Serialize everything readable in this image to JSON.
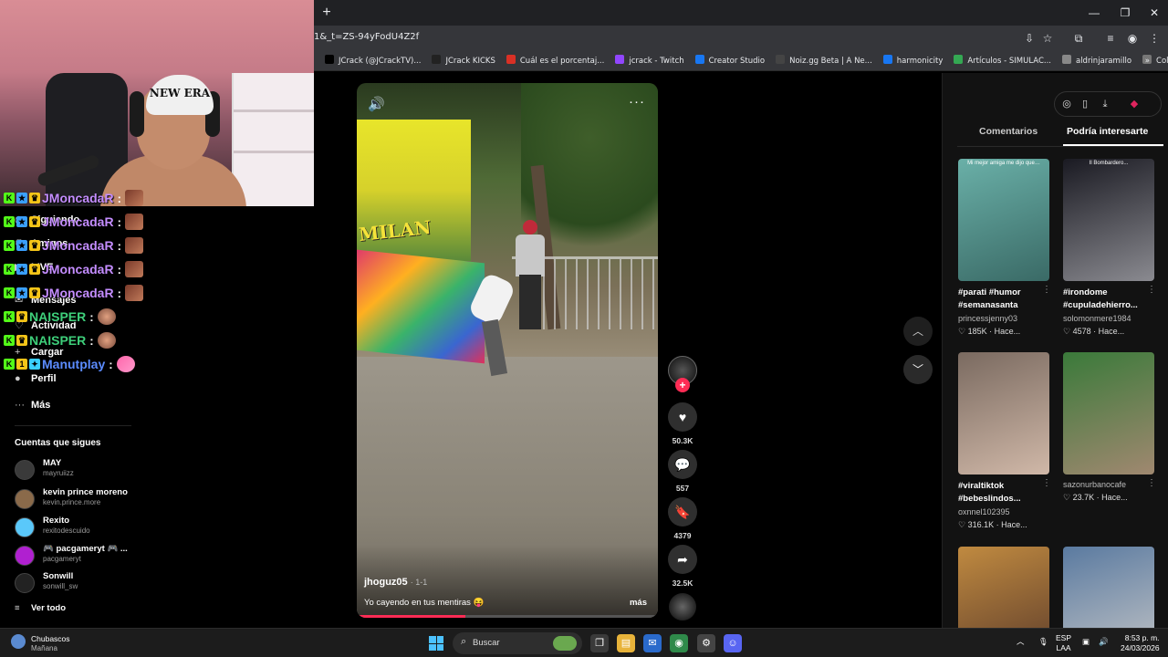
{
  "browser": {
    "new_tab": "+",
    "window_controls": [
      "—",
      "❐",
      "✕"
    ],
    "url": "1&_t=ZS-94yFodU4Z2f",
    "bookmarks": [
      {
        "label": "JCrack (@JCrackTV)...",
        "color": "#000000"
      },
      {
        "label": "JCrack KICKS",
        "color": "#222222"
      },
      {
        "label": "Cuál es el porcentaj...",
        "color": "#d93025"
      },
      {
        "label": "jcrack - Twitch",
        "color": "#9146ff"
      },
      {
        "label": "Creator Studio",
        "color": "#1877f2"
      },
      {
        "label": "Noiz.gg Beta | A Ne...",
        "color": "#444444"
      },
      {
        "label": "harmonicity",
        "color": "#1877f2"
      },
      {
        "label": "Artículos - SIMULAC...",
        "color": "#34a853"
      },
      {
        "label": "aldrinjaramillo",
        "color": "#888888"
      },
      {
        "label": "Colección de M_blei...",
        "color": "#777777"
      }
    ],
    "bookmarks_overflow": "»"
  },
  "webcam": {
    "cap_text": "NEW ERA"
  },
  "chat": [
    {
      "user": "JMoncadaR",
      "color": "#c48dff",
      "badges": [
        "K",
        "★",
        "♛"
      ]
    },
    {
      "user": "JMoncadaR",
      "color": "#c48dff",
      "badges": [
        "K",
        "★",
        "♛"
      ]
    },
    {
      "user": "JMoncadaR",
      "color": "#c48dff",
      "badges": [
        "K",
        "★",
        "♛"
      ]
    },
    {
      "user": "JMoncadaR",
      "color": "#c48dff",
      "badges": [
        "K",
        "★",
        "♛"
      ]
    },
    {
      "user": "JMoncadaR",
      "color": "#c48dff",
      "badges": [
        "K",
        "★",
        "♛"
      ]
    },
    {
      "user": "NAISPER",
      "color": "#3ecf7a",
      "badges": [
        "K",
        "♛"
      ]
    },
    {
      "user": "NAISPER",
      "color": "#3ecf7a",
      "badges": [
        "K",
        "♛"
      ]
    },
    {
      "user": "Manutplay",
      "color": "#5b8cff",
      "badges": [
        "K",
        "1",
        "✦"
      ]
    }
  ],
  "chat_colon": ":",
  "sidebar": {
    "nav": [
      {
        "label": "Siguiendo",
        "icon": "following-icon"
      },
      {
        "label": "Amigos",
        "icon": "friends-icon"
      },
      {
        "label": "LIVE",
        "icon": "live-icon"
      },
      {
        "label": "Mensajes",
        "icon": "messages-icon"
      },
      {
        "label": "Actividad",
        "icon": "activity-icon"
      },
      {
        "label": "Cargar",
        "icon": "upload-icon"
      },
      {
        "label": "Perfil",
        "icon": "profile-icon"
      },
      {
        "label": "Más",
        "icon": "more-icon"
      }
    ],
    "following_title": "Cuentas que sigues",
    "accounts": [
      {
        "name": "MAY",
        "handle": "mayruiizz",
        "color": "#3a3a3a"
      },
      {
        "name": "kevin prince moreno",
        "handle": "kevin.prince.more",
        "color": "#8a6a4a"
      },
      {
        "name": "Rexito",
        "handle": "rexitodescuido",
        "color": "#5ac8fa"
      },
      {
        "name": "🎮 pacgameryt 🎮 ...",
        "handle": "pacgameryt",
        "color": "#b020d0"
      },
      {
        "name": "Sonwill",
        "handle": "sonwill_sw",
        "color": "#222222"
      }
    ],
    "see_all": "Ver todo"
  },
  "video": {
    "sign_text": "MILAN",
    "author": "jhoguz05",
    "ago": "· 1-1",
    "caption": "Yo cayendo en tus mentiras 😝",
    "more": "más",
    "progress": 0.36,
    "actions": [
      {
        "name": "like",
        "icon": "♥",
        "count": "50.3K"
      },
      {
        "name": "comment",
        "icon": "💬",
        "count": "557"
      },
      {
        "name": "save",
        "icon": "🔖",
        "count": "4379"
      },
      {
        "name": "share",
        "icon": "➦",
        "count": "32.5K"
      }
    ],
    "sound_icon": "🔊",
    "more_icon": "···",
    "follow_plus": "+"
  },
  "nav_buttons": {
    "up": "︿",
    "down": "﹀"
  },
  "right_panel": {
    "tabs": [
      "Comentarios",
      "Podría interesarte"
    ],
    "active_tab": 1,
    "cards": [
      {
        "title": "#parati #humor #semanasanta",
        "user": "princessjenny03",
        "likes": "185K",
        "ago": "Hace...",
        "thumb_text": "Mi mejor amiga me dijo que…",
        "c1": "#6ab0a8",
        "c2": "#3a6a66"
      },
      {
        "title": "#irondome #cupuladehierro...",
        "user": "solomonmere1984",
        "likes": "4578",
        "ago": "Hace...",
        "thumb_text": "Il Bombardero...",
        "c1": "#1a1a22",
        "c2": "#8a8a90"
      },
      {
        "title": "#viraltiktok #bebeslindos...",
        "user": "oxnnel102395",
        "likes": "316.1K",
        "ago": "Hace...",
        "thumb_text": "",
        "c1": "#7a6a60",
        "c2": "#d0b8a8"
      },
      {
        "title": "",
        "user": "sazonurbanocafe",
        "likes": "23.7K",
        "ago": "Hace...",
        "thumb_text": "",
        "c1": "#3a7a3a",
        "c2": "#a08870"
      },
      {
        "title": "",
        "user": "",
        "likes": "",
        "ago": "",
        "thumb_text": "",
        "c1": "#c08a40",
        "c2": "#5a3a2a"
      },
      {
        "title": "",
        "user": "",
        "likes": "",
        "ago": "",
        "thumb_text": "",
        "c1": "#5a7aa0",
        "c2": "#c8c8c8"
      }
    ]
  },
  "taskbar": {
    "weather_title": "Chubascos",
    "weather_sub": "Mañana",
    "search": "Buscar",
    "lang": "ESP",
    "lang2": "LAA",
    "time": "8:53 p. m.",
    "date": "24/03/2026"
  }
}
